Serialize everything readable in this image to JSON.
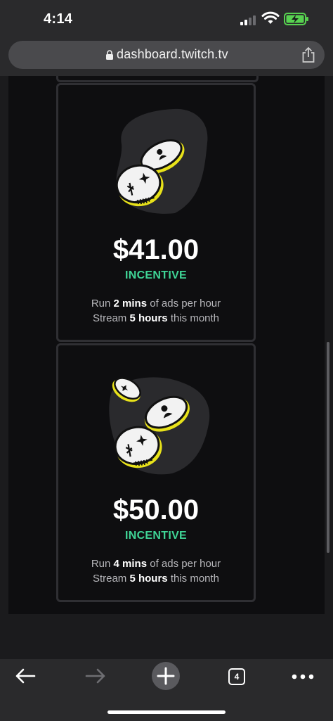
{
  "status_bar": {
    "time": "4:14"
  },
  "browser": {
    "url": "dashboard.twitch.tv",
    "tab_count": "4"
  },
  "cards": [
    {
      "amount": "$41.00",
      "label": "INCENTIVE",
      "line1": {
        "prefix": "Run ",
        "bold": "2 mins",
        "suffix": " of ads per hour"
      },
      "line2": {
        "prefix": "Stream ",
        "bold": "5 hours",
        "suffix": " this month"
      }
    },
    {
      "amount": "$50.00",
      "label": "INCENTIVE",
      "line1": {
        "prefix": "Run ",
        "bold": "4 mins",
        "suffix": " of ads per hour"
      },
      "line2": {
        "prefix": "Stream ",
        "bold": "5 hours",
        "suffix": " this month"
      }
    }
  ],
  "colors": {
    "accent_green": "#3fd596",
    "card_border": "#2f2f33",
    "background": "#0e0e10",
    "coin_outline": "#e8e21a"
  },
  "icons": [
    "lock-icon",
    "share-icon",
    "back-arrow-icon",
    "forward-arrow-icon",
    "plus-icon",
    "tabs-icon",
    "more-icon",
    "coins-illustration"
  ]
}
